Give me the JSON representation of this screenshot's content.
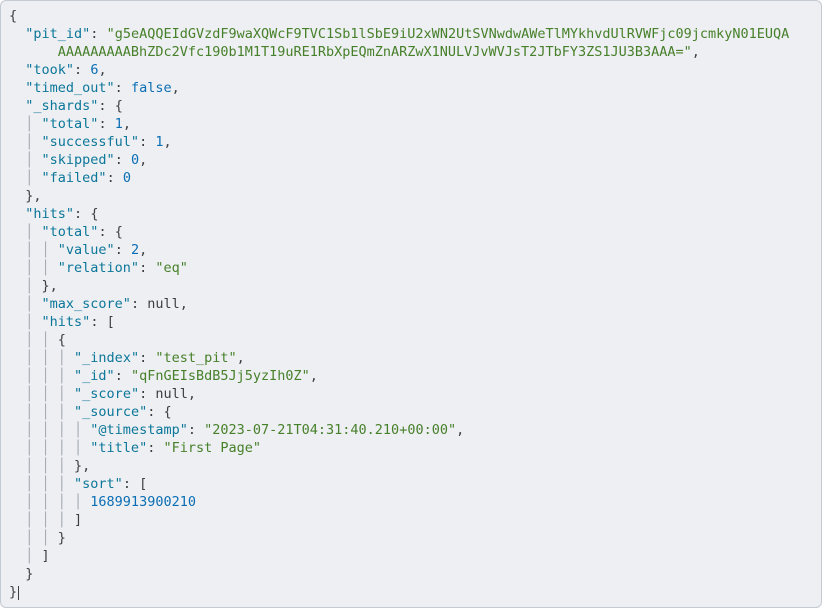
{
  "keys": {
    "pit_id": "\"pit_id\"",
    "took": "\"took\"",
    "timed_out": "\"timed_out\"",
    "_shards": "\"_shards\"",
    "total": "\"total\"",
    "successful": "\"successful\"",
    "skipped": "\"skipped\"",
    "failed": "\"failed\"",
    "hits": "\"hits\"",
    "value": "\"value\"",
    "relation": "\"relation\"",
    "max_score": "\"max_score\"",
    "_index": "\"_index\"",
    "_id": "\"_id\"",
    "_score": "\"_score\"",
    "_source": "\"_source\"",
    "@timestamp": "\"@timestamp\"",
    "title": "\"title\"",
    "sort": "\"sort\""
  },
  "vals": {
    "pit_id_part1": "\"g5eAQQEIdGVzdF9waXQWcF9TVC1Sb1lSbE9iU2xWN2UtSVNwdwAWeTlMYkhvdUlRVWFjc09jcmkyN01EUQA",
    "pit_id_part2": "AAAAAAAAABhZDc2Vfc190b1M1T19uRE1RbXpEQmZnARZwX1NULVJvWVJsT2JTbFY3ZS1JU3B3AAA=\"",
    "took": "6",
    "timed_out": "false",
    "shards_total": "1",
    "shards_successful": "1",
    "shards_skipped": "0",
    "shards_failed": "0",
    "hits_total_value": "2",
    "hits_relation": "\"eq\"",
    "max_score": "null",
    "hit0_index": "\"test_pit\"",
    "hit0_id": "\"qFnGEIsBdB5Jj5yzIh0Z\"",
    "hit0_score": "null",
    "hit0_ts": "\"2023-07-21T04:31:40.210+00:00\"",
    "hit0_title": "\"First Page\"",
    "hit0_sort0": "1689913900210"
  },
  "chart_data": {
    "type": "table",
    "note": "JSON API response",
    "data": {
      "pit_id": "g5eAQQEIdGVzdF9waXQWcF9TVC1Sb1lSbE9iU2xWN2UtSVNwdwAWeTlMYkhvdUlRVWFjc09jcmkyN01EUQAAAAAAAAAABhZDc2Vfc190b1M1T19uRE1RbXpEQmZnARZwX1NULVJvWVJsT2JTbFY3ZS1JU3B3AAA=",
      "took": 6,
      "timed_out": false,
      "_shards": {
        "total": 1,
        "successful": 1,
        "skipped": 0,
        "failed": 0
      },
      "hits": {
        "total": {
          "value": 2,
          "relation": "eq"
        },
        "max_score": null,
        "hits": [
          {
            "_index": "test_pit",
            "_id": "qFnGEIsBdB5Jj5yzIh0Z",
            "_score": null,
            "_source": {
              "@timestamp": "2023-07-21T04:31:40.210+00:00",
              "title": "First Page"
            },
            "sort": [
              1689913900210
            ]
          }
        ]
      }
    }
  }
}
